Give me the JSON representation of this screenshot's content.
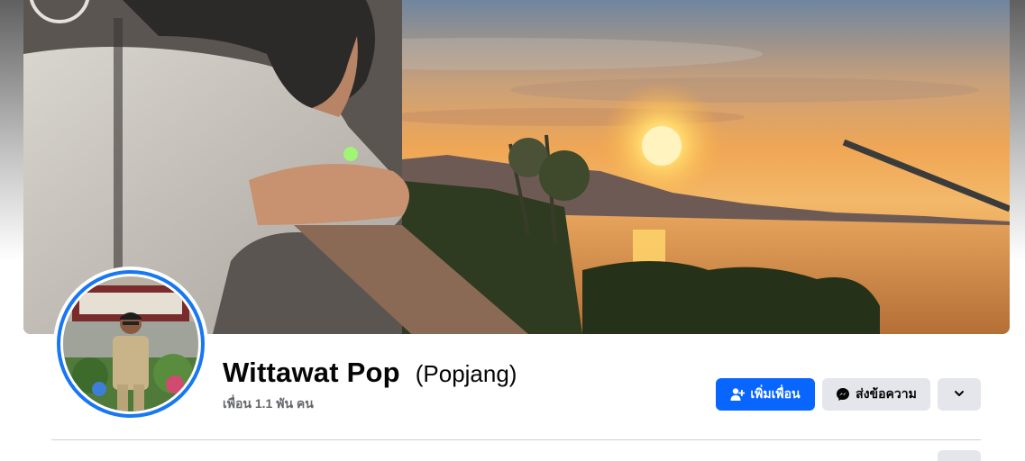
{
  "profile": {
    "name": "Wittawat Pop",
    "alternate_name": "(Popjang)",
    "friends_count": "เพื่อน 1.1 พัน คน"
  },
  "actions": {
    "add_friend_label": "เพิ่มเพื่อน",
    "message_label": "ส่งข้อความ",
    "more_icon": "chevron-down-icon"
  },
  "colors": {
    "accent": "#0866ff",
    "avatar_ring": "#1877f2",
    "secondary_button": "#e4e6eb",
    "muted_text": "#65676b"
  },
  "images": {
    "cover_photo": "person leaning on railing watching sunset over river",
    "profile_picture": "person in khaki uniform standing outdoors"
  }
}
